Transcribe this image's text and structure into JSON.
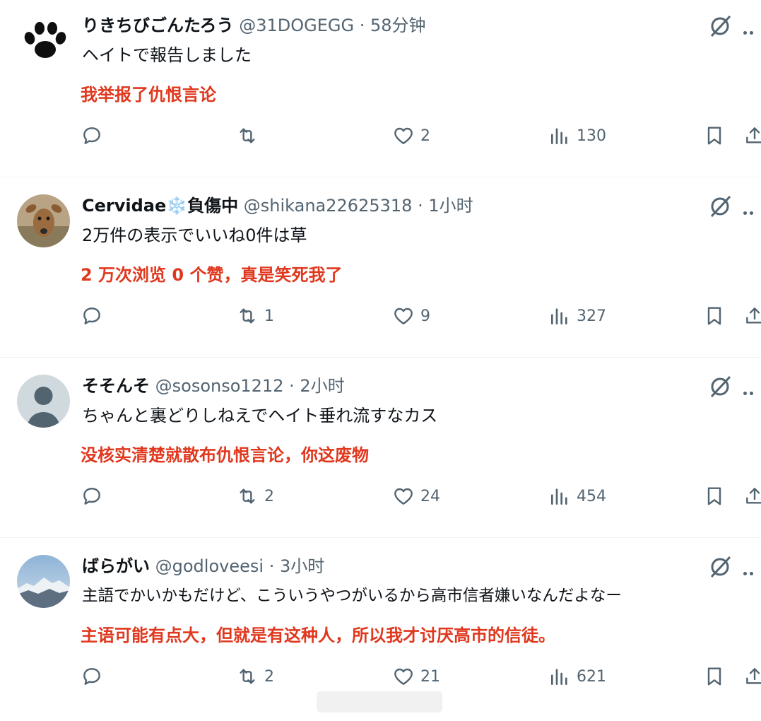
{
  "replies": [
    {
      "display_name": "りきちびごんたろう",
      "handle": "@31DOGEGG",
      "time": "58分钟",
      "text": "ヘイトで報告しました",
      "translation": "我举报了仇恨言论",
      "avatar": "paw-print",
      "counts": {
        "reply": "",
        "retweet": "",
        "like": "2",
        "views": "130"
      }
    },
    {
      "display_name": "Cervidae❄️負傷中",
      "handle": "@shikana22625318",
      "time": "1小时",
      "text": "2万件の表示でいいね0件は草",
      "translation": "2 万次浏览 0 个赞，真是笑死我了",
      "avatar": "deer-photo",
      "counts": {
        "reply": "",
        "retweet": "1",
        "like": "9",
        "views": "327"
      }
    },
    {
      "display_name": "そそんそ",
      "handle": "@sosonso1212",
      "time": "2小时",
      "text": "ちゃんと裏どりしねえでヘイト垂れ流すなカス",
      "translation": "没核实清楚就散布仇恨言论，你这废物",
      "avatar": "default-avatar",
      "counts": {
        "reply": "",
        "retweet": "2",
        "like": "24",
        "views": "454"
      }
    },
    {
      "display_name": "ばらがい",
      "handle": "@godloveesi",
      "time": "3小时",
      "text": "主語でかいかもだけど、こういうやつがいるから高市信者嫌いなんだよなー",
      "translation": "主语可能有点大，但就是有这种人，所以我才讨厌高市的信徒。",
      "avatar": "mountain-photo",
      "counts": {
        "reply": "",
        "retweet": "2",
        "like": "21",
        "views": "621"
      }
    }
  ],
  "separator": "·",
  "colors": {
    "translation": "#e0381e",
    "muted": "#536471",
    "text": "#0f1419"
  }
}
